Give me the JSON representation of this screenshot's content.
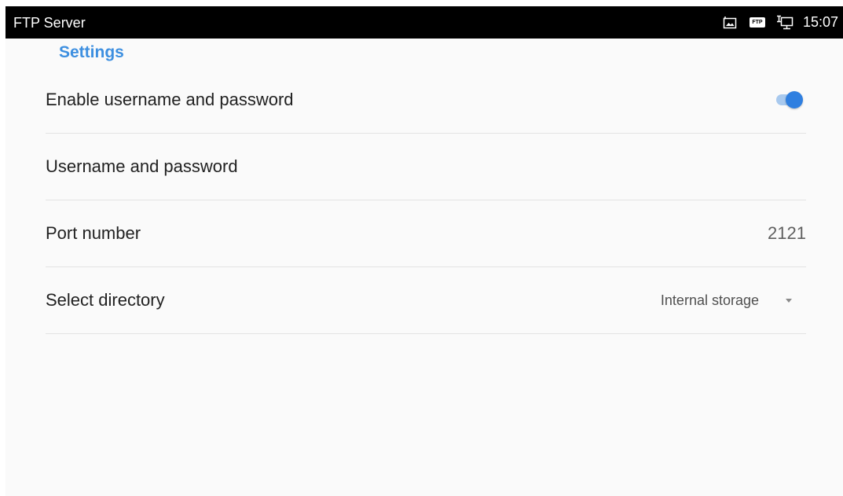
{
  "status_bar": {
    "app_title": "FTP Server",
    "time": "15:07",
    "icons": [
      "screenshot-icon",
      "ftp-icon",
      "network-monitor-icon"
    ],
    "ftp_badge_text": "FTP"
  },
  "settings": {
    "section_header": "Settings",
    "enable_credentials": {
      "label": "Enable username and password",
      "enabled": true
    },
    "credentials": {
      "label": "Username and password"
    },
    "port": {
      "label": "Port number",
      "value": "2121"
    },
    "directory": {
      "label": "Select directory",
      "selected": "Internal storage"
    }
  },
  "colors": {
    "accent": "#2f7fe0",
    "header_text": "#3d8fe0",
    "background": "#fafafa",
    "status_bar": "#000000"
  }
}
